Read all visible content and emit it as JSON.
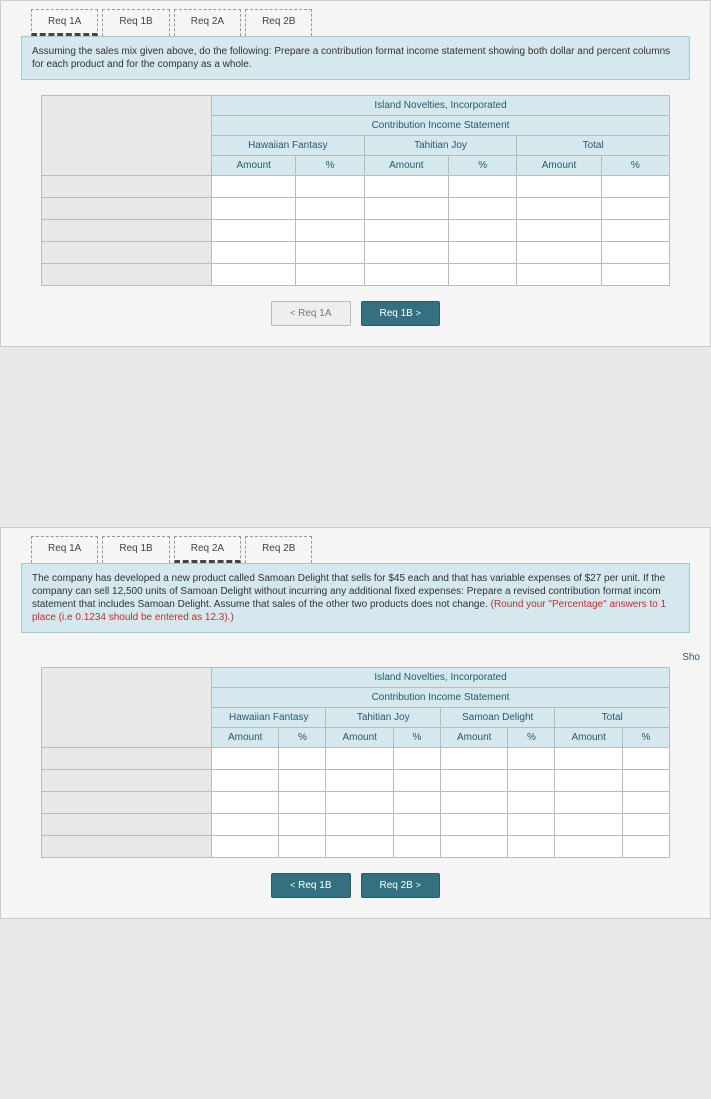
{
  "panel1": {
    "tabs": [
      "Req 1A",
      "Req 1B",
      "Req 2A",
      "Req 2B"
    ],
    "active_tab_index": 0,
    "instruction": "Assuming the sales mix given above, do the following: Prepare a contribution format income statement showing both dollar and percent columns for each product and for the company as a whole.",
    "table": {
      "title1": "Island Novelties, Incorporated",
      "title2": "Contribution Income Statement",
      "groups": [
        "Hawaiian Fantasy",
        "Tahitian Joy",
        "Total"
      ],
      "subcols": [
        "Amount",
        "%"
      ]
    },
    "nav_prev": "Req 1A",
    "nav_next": "Req 1B"
  },
  "panel2": {
    "tabs": [
      "Req 1A",
      "Req 1B",
      "Req 2A",
      "Req 2B"
    ],
    "active_tab_index": 2,
    "instruction_plain": "The company has developed a new product called Samoan Delight that sells for $45 each and that has variable expenses of $27 per unit. If the company can sell 12,500 units of Samoan Delight without incurring any additional fixed expenses: Prepare a revised contribution format incom statement that includes Samoan Delight. Assume that sales of the other two products does not change. ",
    "instruction_red": "(Round your \"Percentage\" answers to 1 place (i.e 0.1234 should be entered as 12.3).)",
    "show_text": "Sho",
    "table": {
      "title1": "Island Novelties, Incorporated",
      "title2": "Contribution Income Statement",
      "groups": [
        "Hawaiian Fantasy",
        "Tahitian Joy",
        "Samoan Delight",
        "Total"
      ],
      "subcols": [
        "Amount",
        "%"
      ]
    },
    "nav_prev": "Req 1B",
    "nav_next": "Req 2B"
  }
}
